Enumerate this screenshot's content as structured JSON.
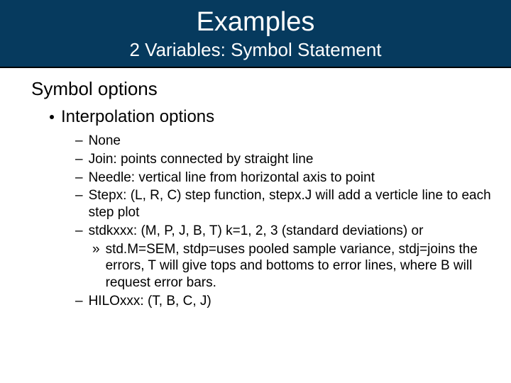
{
  "header": {
    "title": "Examples",
    "subtitle": "2 Variables: Symbol Statement"
  },
  "section": "Symbol options",
  "bullet1": "Interpolation options",
  "items": [
    {
      "text": "None"
    },
    {
      "text": "Join: points connected by straight line"
    },
    {
      "text": "Needle: vertical line from horizontal axis to point"
    },
    {
      "text": "Stepx: (L, R, C) step function, stepx.J will add a verticle line to each step plot"
    },
    {
      "text": "stdkxxx: (M, P, J, B, T) k=1, 2, 3 (standard deviations) or",
      "sub": "std.M=SEM, stdp=uses pooled sample variance, stdj=joins the errors, T will give tops and bottoms to error lines, where B will request error bars."
    },
    {
      "text": "HILOxxx: (T, B, C, J)"
    }
  ]
}
